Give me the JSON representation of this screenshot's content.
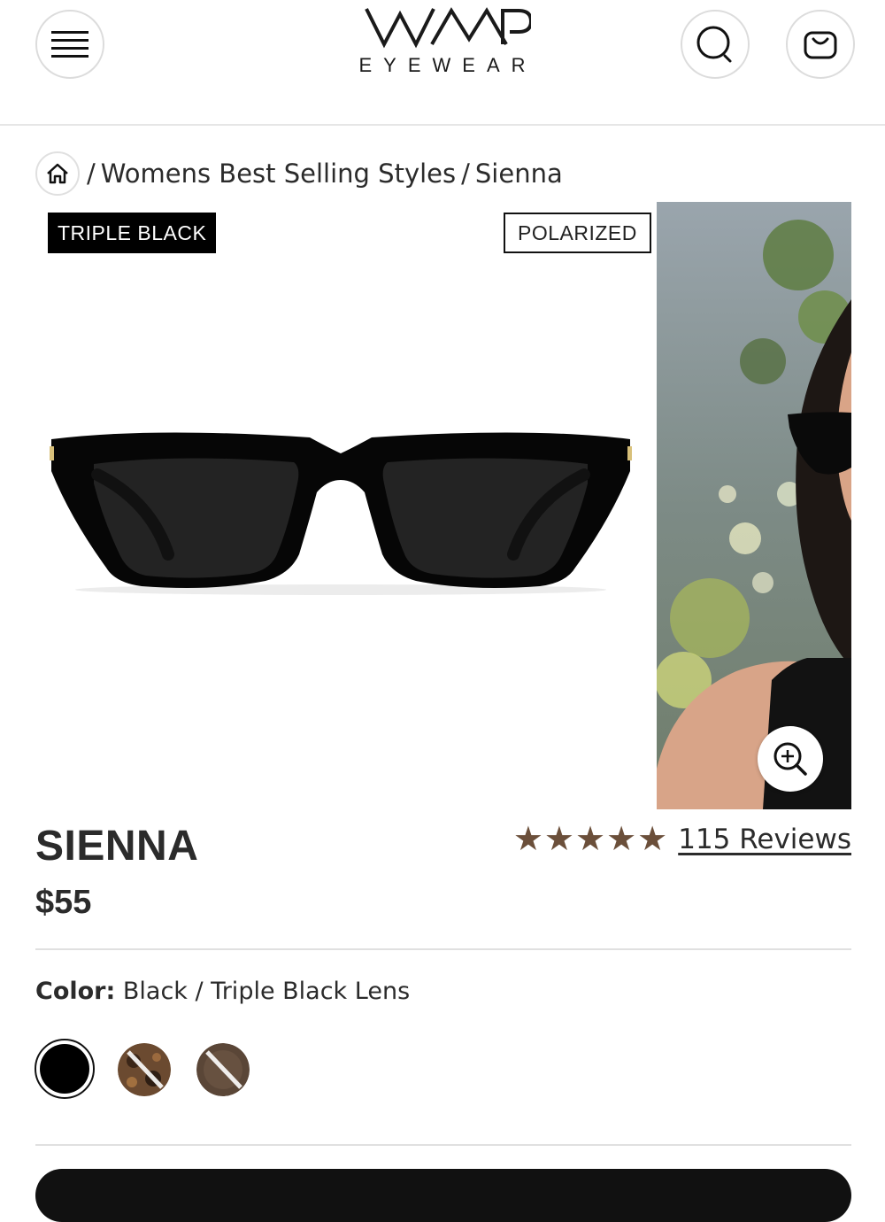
{
  "header": {
    "logo_mark": "WMP",
    "logo_sub": "EYEWEAR",
    "menu_icon": "hamburger-icon",
    "search_icon": "search-icon",
    "cart_icon": "bag-icon"
  },
  "breadcrumb": {
    "home_icon": "home-icon",
    "items": [
      "Womens Best Selling Styles",
      "Sienna"
    ],
    "separator": "/"
  },
  "gallery": {
    "badge_left": "TRIPLE BLACK",
    "badge_right": "POLARIZED",
    "zoom_icon": "zoom-in-icon"
  },
  "product": {
    "name": "SIENNA",
    "price": "$55",
    "rating": 5,
    "star_color": "#6b4f3a",
    "reviews_label": "115  Reviews"
  },
  "color": {
    "label": "Color:",
    "value": "Black / Triple Black Lens",
    "swatches": [
      {
        "name": "Black",
        "selected": true,
        "color": "#000000"
      },
      {
        "name": "Tortoise",
        "selected": false,
        "color": "#6b4a30",
        "unavailable": true
      },
      {
        "name": "Brown",
        "selected": false,
        "color": "#5a4637",
        "unavailable": true
      }
    ]
  }
}
